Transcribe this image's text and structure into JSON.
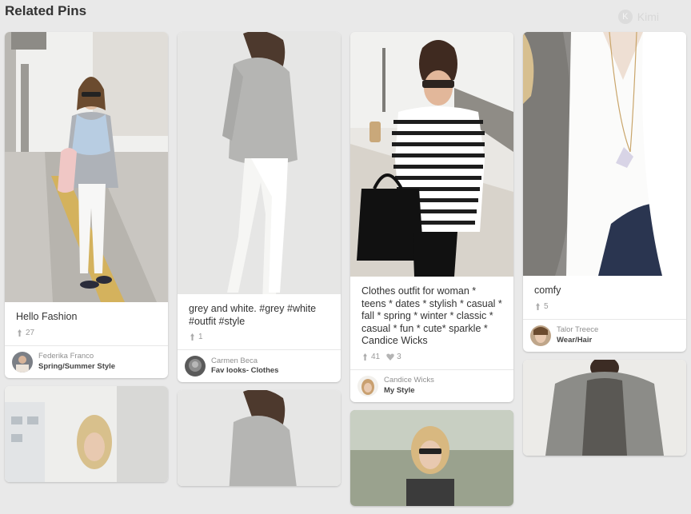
{
  "header": {
    "title": "Related Pins",
    "user_name": "Kimi",
    "user_initial": "K"
  },
  "pins": [
    {
      "description": "Hello Fashion",
      "repins": "27",
      "likes": "",
      "pinner": "Federika Franco",
      "board": "Spring/Summer Style"
    },
    {
      "description": "grey and white. #grey #white #outfit #style",
      "repins": "1",
      "likes": "",
      "pinner": "Carmen Beca",
      "board": "Fav looks- Clothes"
    },
    {
      "description": "Clothes outfit for woman * teens * dates * stylish * casual * fall * spring * winter * classic * casual * fun * cute* sparkle * Candice Wicks",
      "repins": "41",
      "likes": "3",
      "pinner": "Candice Wicks",
      "board": "My Style"
    },
    {
      "description": "comfy",
      "repins": "5",
      "likes": "",
      "pinner": "Talor Treece",
      "board": "Wear/Hair"
    }
  ],
  "icons": {
    "repin": "pin-icon",
    "like": "heart-icon"
  }
}
